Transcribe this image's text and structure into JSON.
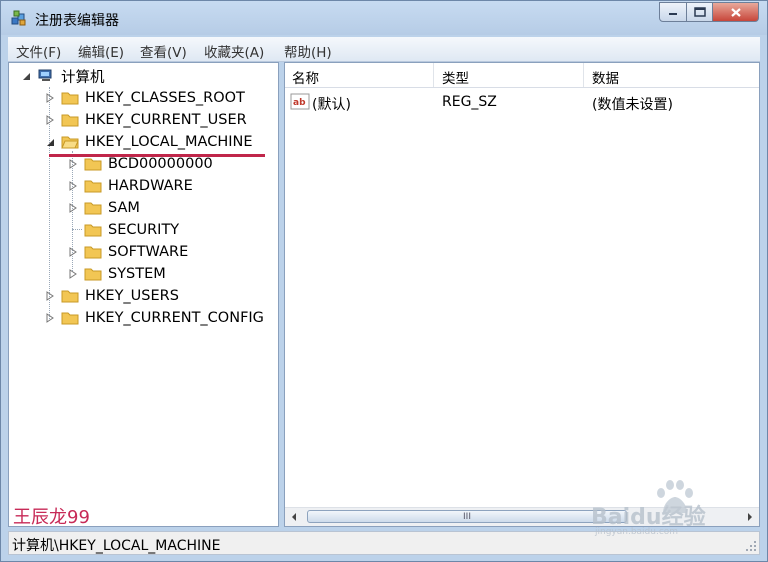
{
  "window": {
    "title": "注册表编辑器"
  },
  "menu": [
    "文件(F)",
    "编辑(E)",
    "查看(V)",
    "收藏夹(A)",
    "帮助(H)"
  ],
  "tree": {
    "root": "计算机",
    "hives": [
      "HKEY_CLASSES_ROOT",
      "HKEY_CURRENT_USER",
      "HKEY_LOCAL_MACHINE"
    ],
    "local_machine_children": [
      "BCD00000000",
      "HARDWARE",
      "SAM",
      "SECURITY",
      "SOFTWARE",
      "SYSTEM"
    ],
    "hives_after": [
      "HKEY_USERS",
      "HKEY_CURRENT_CONFIG"
    ]
  },
  "list": {
    "headers": {
      "name": "名称",
      "type": "类型",
      "data": "数据"
    },
    "rows": [
      {
        "name": "(默认)",
        "type": "REG_SZ",
        "data": "(数值未设置)",
        "icon": "string-value-icon"
      }
    ]
  },
  "scroll": {
    "thumb_grip": "III"
  },
  "status": {
    "path": "计算机\\HKEY_LOCAL_MACHINE"
  },
  "watermarks": {
    "author": "王辰龙99",
    "baidu_brand": "Baidu经验",
    "baidu_url": "jingyan.baidu.com"
  },
  "colors": {
    "title_bg": "#bcd2ea",
    "close": "#c7463a",
    "underline": "#c0264a",
    "watermark": "#c72a57"
  }
}
